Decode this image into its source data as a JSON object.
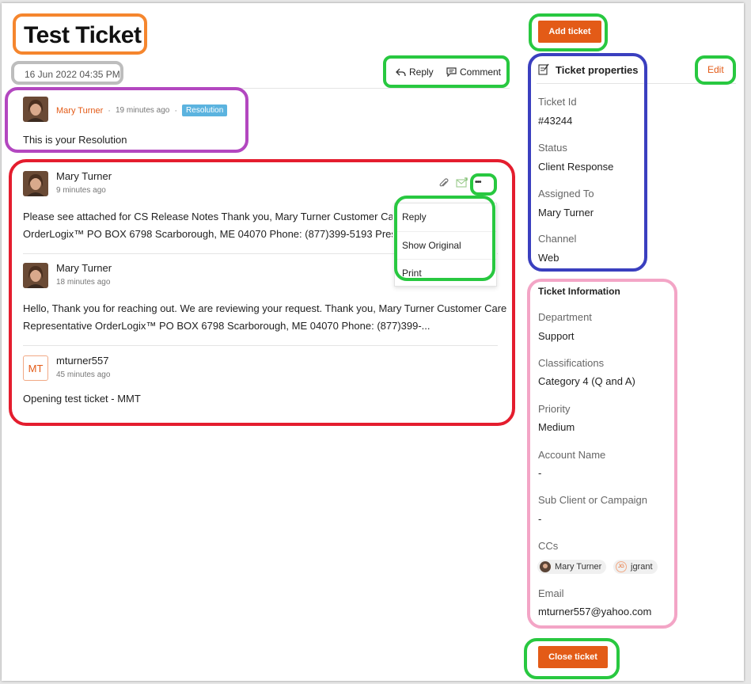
{
  "ticket": {
    "title": "Test Ticket",
    "created_at": "16 Jun 2022 04:35 PM"
  },
  "actions": {
    "reply_label": "Reply",
    "comment_label": "Comment"
  },
  "resolution": {
    "author": "Mary Turner",
    "dot": "·",
    "time": "19 minutes ago",
    "badge": "Resolution",
    "text": "This is your Resolution"
  },
  "thread": [
    {
      "author": "Mary Turner",
      "time": "9 minutes ago",
      "line1": "Please see attached for CS Release Notes Thank you, Mary Turner Customer Care Re",
      "line2": "OrderLogix™ PO BOX 6798 Scarborough, ME 04070 Phone: (877)399-5193 Press"
    },
    {
      "author": "Mary Turner",
      "time": "18 minutes ago",
      "line1": "Hello, Thank you for reaching out. We are reviewing your request. Thank you, Mary Turner Customer Care",
      "line2": "Representative OrderLogix™ PO BOX 6798 Scarborough, ME 04070 Phone: (877)399-..."
    },
    {
      "author": "mturner557",
      "initials": "MT",
      "time": "45 minutes ago",
      "line1": "Opening test ticket - MMT"
    }
  ],
  "more_menu": {
    "trigger": "•••",
    "items": [
      "Reply",
      "Show Original",
      "Print"
    ]
  },
  "add_ticket_label": "Add ticket",
  "close_ticket_label": "Close ticket",
  "properties": {
    "title": "Ticket properties",
    "edit_label": "Edit",
    "fields": [
      {
        "label": "Ticket Id",
        "value": "#43244"
      },
      {
        "label": "Status",
        "value": "Client Response"
      },
      {
        "label": "Assigned To",
        "value": "Mary Turner"
      },
      {
        "label": "Channel",
        "value": "Web"
      }
    ]
  },
  "information": {
    "title": "Ticket Information",
    "fields": [
      {
        "label": "Department",
        "value": "Support"
      },
      {
        "label": "Classifications",
        "value": "Category 4 (Q and A)"
      },
      {
        "label": "Priority",
        "value": "Medium"
      },
      {
        "label": "Account Name",
        "value": "-"
      },
      {
        "label": "Sub Client or Campaign",
        "value": "-"
      }
    ],
    "ccs_label": "CCs",
    "ccs": [
      {
        "name": "Mary Turner"
      },
      {
        "name": "jgrant",
        "initials": "JG"
      }
    ],
    "email_label": "Email",
    "email_value": "mturner557@yahoo.com"
  },
  "colors": {
    "accent_orange": "#e35b17",
    "resolution_badge": "#5bb3df",
    "annot_orange": "#f5862e",
    "annot_gray": "#bdbdbd",
    "annot_green": "#28c840",
    "annot_purple": "#b347c0",
    "annot_red": "#e41d2e",
    "annot_blue": "#3a3fbf",
    "annot_pink": "#f3a5c6"
  }
}
